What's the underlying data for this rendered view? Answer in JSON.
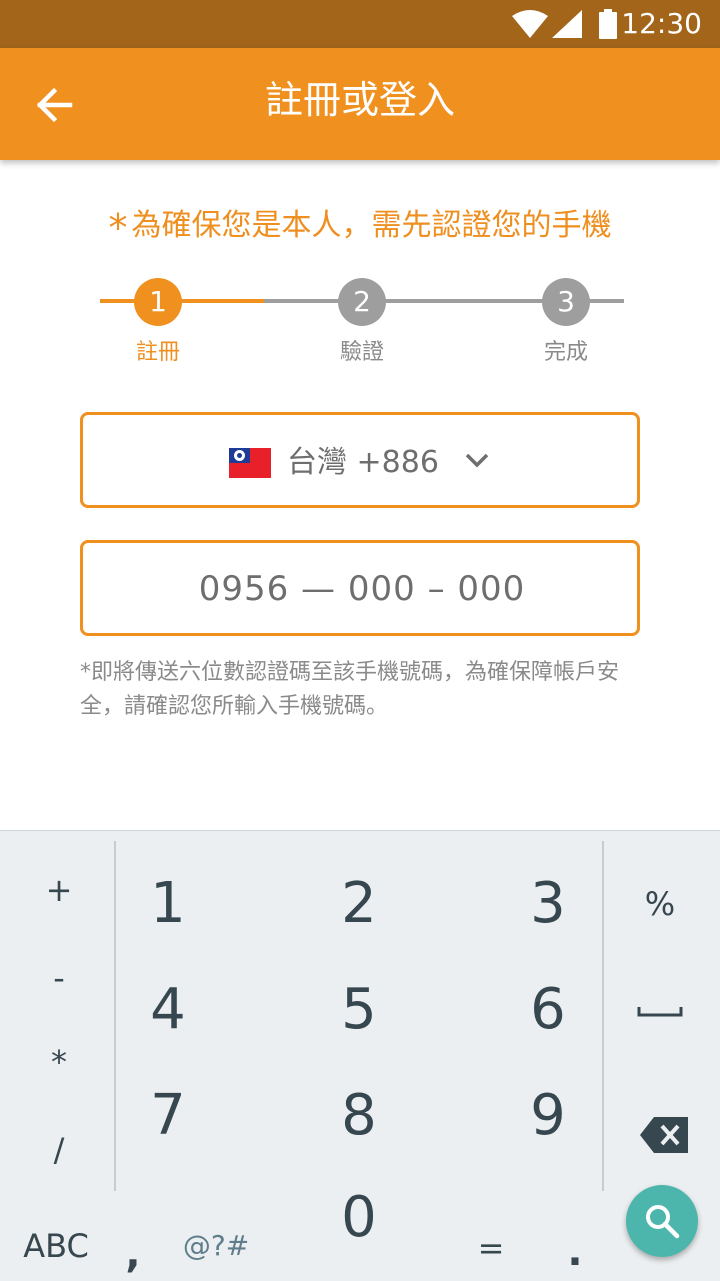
{
  "status_bar": {
    "time": "12:30",
    "icons": [
      "wifi-icon",
      "signal-icon",
      "battery-icon"
    ]
  },
  "app_bar": {
    "title": "註冊或登入",
    "back_icon": "arrow-back-icon"
  },
  "notice": {
    "star": "*",
    "text": "為確保您是本人，需先認證您的手機"
  },
  "stepper": {
    "steps": [
      {
        "number": "1",
        "label": "註冊",
        "state": "active"
      },
      {
        "number": "2",
        "label": "驗證",
        "state": "pending"
      },
      {
        "number": "3",
        "label": "完成",
        "state": "pending"
      }
    ]
  },
  "country_selector": {
    "country": "台灣",
    "code": "+886",
    "flag_icon": "taiwan-flag-icon",
    "dropdown_icon": "chevron-down-icon"
  },
  "phone_input": {
    "placeholder": "0956 — 000 – 000"
  },
  "hint": "*即將傳送六位數認證碼至該手機號碼，為確保障帳戶安全，請確認您所輸入手機號碼。",
  "keyboard": {
    "left_symbols": [
      "+",
      "-",
      "*",
      "/"
    ],
    "digits": [
      "1",
      "2",
      "3",
      "4",
      "5",
      "6",
      "7",
      "8",
      "9",
      "0"
    ],
    "right_keys": [
      "%",
      "␣"
    ],
    "bottom_row": [
      "ABC",
      ",",
      "@?#",
      "=",
      "."
    ],
    "search_icon": "search-icon",
    "backspace_icon": "backspace-icon"
  },
  "colors": {
    "status_bar": "#A2651A",
    "primary": "#F0901F",
    "inactive": "#9E9E9E",
    "keyboard_bg": "#ECEFF1",
    "fab": "#4DB6AC"
  }
}
